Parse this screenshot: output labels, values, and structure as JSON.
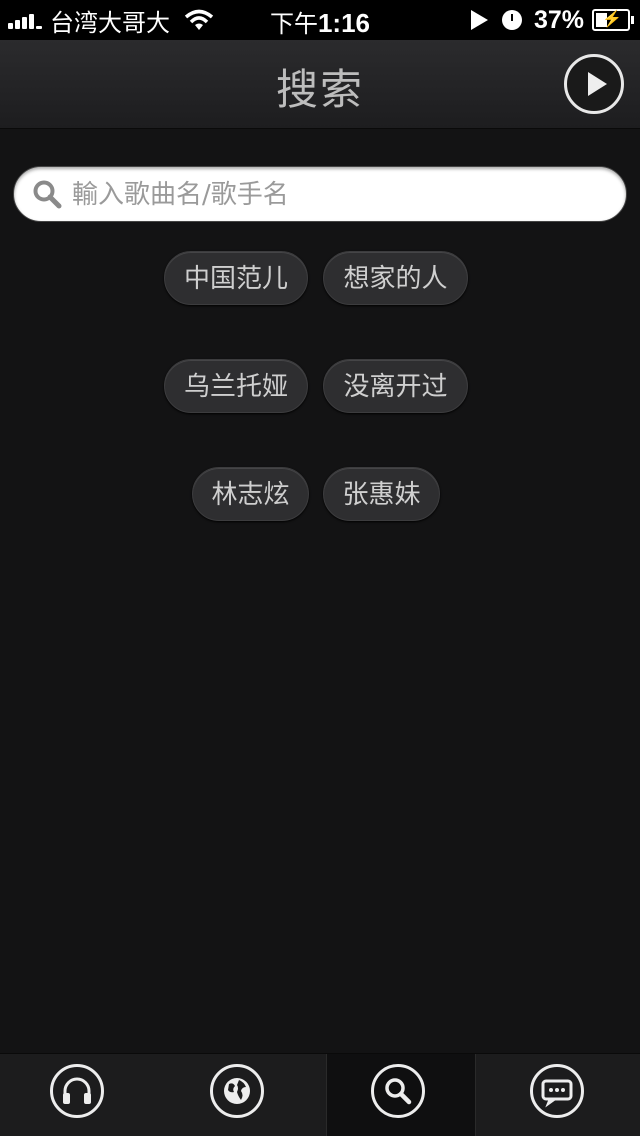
{
  "status_bar": {
    "carrier": "台湾大哥大",
    "time_prefix": "下午",
    "time": "1:16",
    "battery_percent": "37%"
  },
  "nav": {
    "title": "搜索"
  },
  "search": {
    "placeholder": "輸入歌曲名/歌手名"
  },
  "hot_tags": [
    "中国范儿",
    "想家的人",
    "乌兰托娅",
    "没离开过",
    "林志炫",
    "张惠妹"
  ],
  "tabs": [
    {
      "icon": "headphones-icon"
    },
    {
      "icon": "globe-icon"
    },
    {
      "icon": "search-icon",
      "active": true
    },
    {
      "icon": "chat-icon"
    }
  ],
  "colors": {
    "background": "#131314",
    "tag_background": "#2e2e30",
    "icon": "#ededed"
  }
}
